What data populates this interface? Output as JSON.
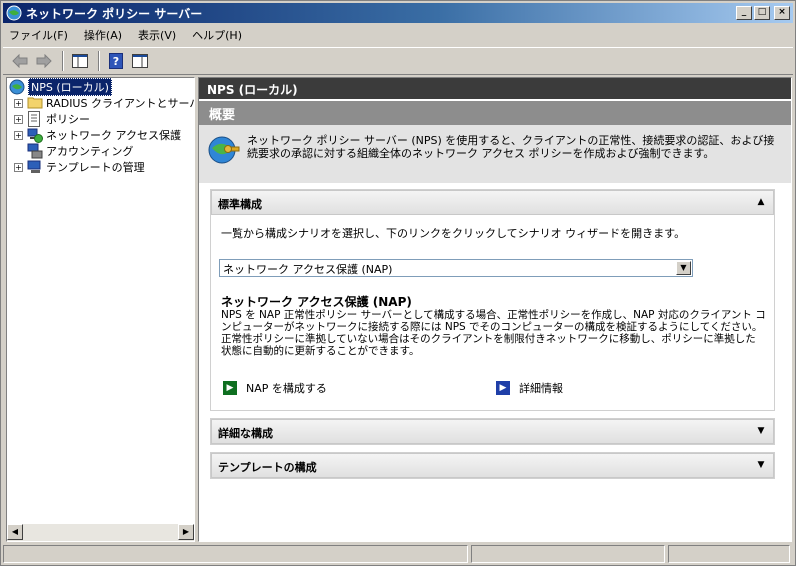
{
  "window": {
    "title": "ネットワーク ポリシー サーバー",
    "controls": {
      "minimize": "_",
      "maximize": "□",
      "close": "×"
    }
  },
  "menu": [
    "ファイル(F)",
    "操作(A)",
    "表示(V)",
    "ヘルプ(H)"
  ],
  "toolbar": {
    "icons": [
      "back-arrow-icon",
      "forward-arrow-icon",
      "show-hide-tree-icon",
      "help-icon",
      "properties-icon"
    ]
  },
  "tree": {
    "root": "NPS (ローカル)",
    "items": [
      {
        "label": "RADIUS クライアントとサーバー",
        "expandable": true,
        "icon": "folder-icon"
      },
      {
        "label": "ポリシー",
        "expandable": true,
        "icon": "policy-icon"
      },
      {
        "label": "ネットワーク アクセス保護",
        "expandable": true,
        "icon": "nap-icon"
      },
      {
        "label": "アカウンティング",
        "expandable": false,
        "icon": "accounting-icon"
      },
      {
        "label": "テンプレートの管理",
        "expandable": true,
        "icon": "template-icon"
      }
    ]
  },
  "main": {
    "header": "NPS (ローカル)",
    "overview": {
      "title": "概要",
      "text": "ネットワーク ポリシー サーバー (NPS) を使用すると、クライアントの正常性、接続要求の認証、および接続要求の承認に対する組織全体のネットワーク アクセス ポリシーを作成および強制できます。"
    },
    "standard": {
      "title": "標準構成",
      "intro": "一覧から構成シナリオを選択し、下のリンクをクリックしてシナリオ ウィザードを開きます。",
      "selected_scenario": "ネットワーク アクセス保護 (NAP)",
      "scenario_title": "ネットワーク アクセス保護 (NAP)",
      "scenario_desc": "NPS を NAP 正常性ポリシー サーバーとして構成する場合、正常性ポリシーを作成し、NAP 対応のクライアント コンピューターがネットワークに接続する際には NPS でそのコンピューターの構成を検証するようにしてください。正常性ポリシーに準拠していない場合はそのクライアントを制限付きネットワークに移動し、ポリシーに準拠した状態に自動的に更新することができます。",
      "configure_link": "NAP を構成する",
      "details_link": "詳細情報"
    },
    "advanced": {
      "title": "詳細な構成"
    },
    "templates": {
      "title": "テンプレートの構成"
    }
  },
  "colors": {
    "title_start": "#0a246a",
    "title_end": "#a6caf0",
    "header_bg": "#3b3b3b",
    "overview_bar": "#8d8d8d",
    "green_arrow": "#0e6f20",
    "blue_arrow": "#1f3fa8"
  }
}
